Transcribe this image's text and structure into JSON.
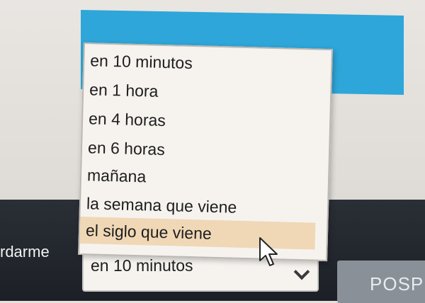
{
  "remind_label": "rdarme",
  "postpone_label": "POSP",
  "select": {
    "value": "en 10 minutos"
  },
  "dropdown": {
    "options": [
      "en 10 minutos",
      "en 1 hora",
      "en 4 horas",
      "en 6 horas",
      "mañana",
      "la semana que viene",
      "el siglo que viene"
    ],
    "highlighted_index": 6
  },
  "colors": {
    "banner": "#2ea6d9",
    "highlight": "#f0d8b6",
    "footer": "#22272d"
  }
}
